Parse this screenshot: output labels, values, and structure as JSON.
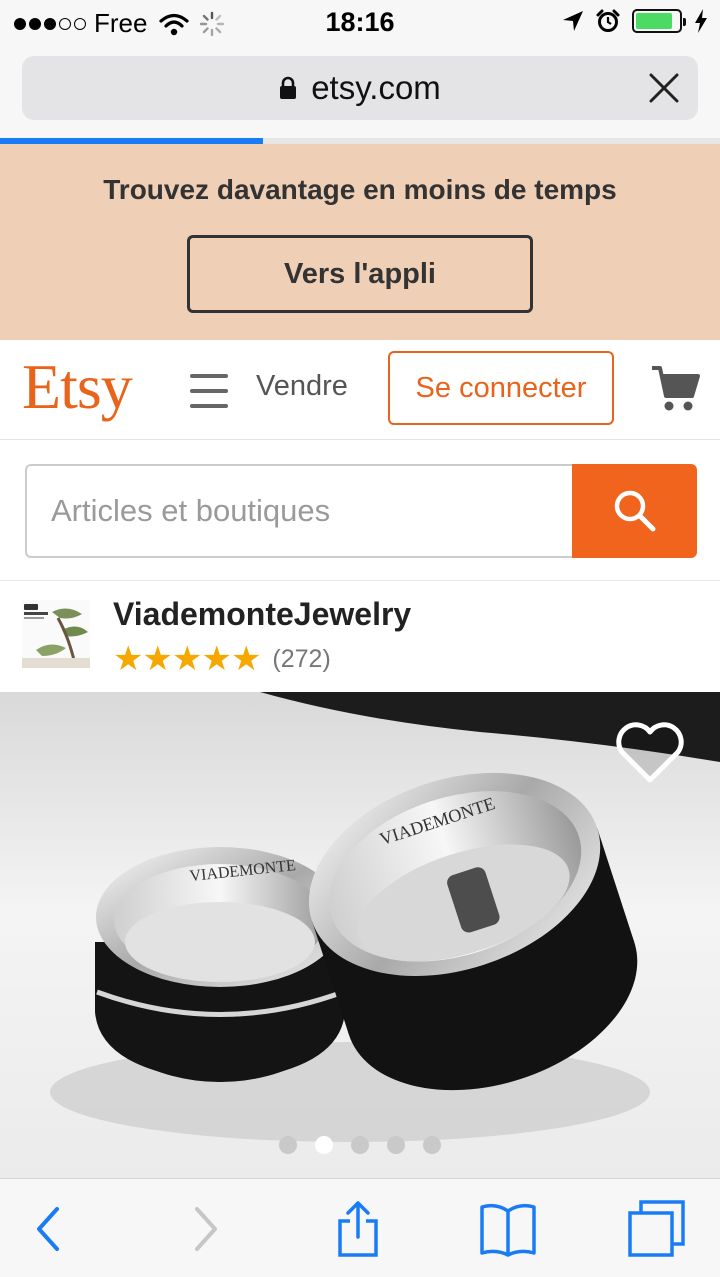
{
  "status_bar": {
    "carrier": "Free",
    "time": "18:16",
    "signal_bars": 3,
    "signal_total": 5,
    "battery_level": 0.85,
    "icons": [
      "wifi-icon",
      "activity-spinner-icon",
      "location-arrow-icon",
      "alarm-icon",
      "battery-icon",
      "charging-bolt-icon"
    ]
  },
  "browser": {
    "url": "etsy.com",
    "page_load_progress": 0.365,
    "icons": [
      "lock-icon",
      "close-icon"
    ]
  },
  "app_banner": {
    "message": "Trouvez davantage en moins de temps",
    "button_label": "Vers l'appli"
  },
  "header": {
    "logo": "Etsy",
    "sell_link": "Vendre",
    "signin_button": "Se connecter",
    "icons": [
      "hamburger-menu-icon",
      "cart-icon"
    ]
  },
  "search": {
    "placeholder": "Articles et boutiques",
    "value": "",
    "icons": [
      "search-icon"
    ]
  },
  "shop": {
    "name": "ViademonteJewelry",
    "rating": 5,
    "review_count": "(272)"
  },
  "product": {
    "carousel_total": 5,
    "carousel_active_index": 1,
    "icons": [
      "favorite-heart-icon"
    ]
  },
  "toolbar": {
    "icons": [
      "back-icon",
      "forward-icon",
      "share-icon",
      "bookmarks-icon",
      "tabs-icon"
    ]
  },
  "colors": {
    "brand_orange": "#f1641e",
    "banner_bg": "#efcfb5",
    "star_color": "#f6a800",
    "ios_blue": "#1a7cf5"
  }
}
